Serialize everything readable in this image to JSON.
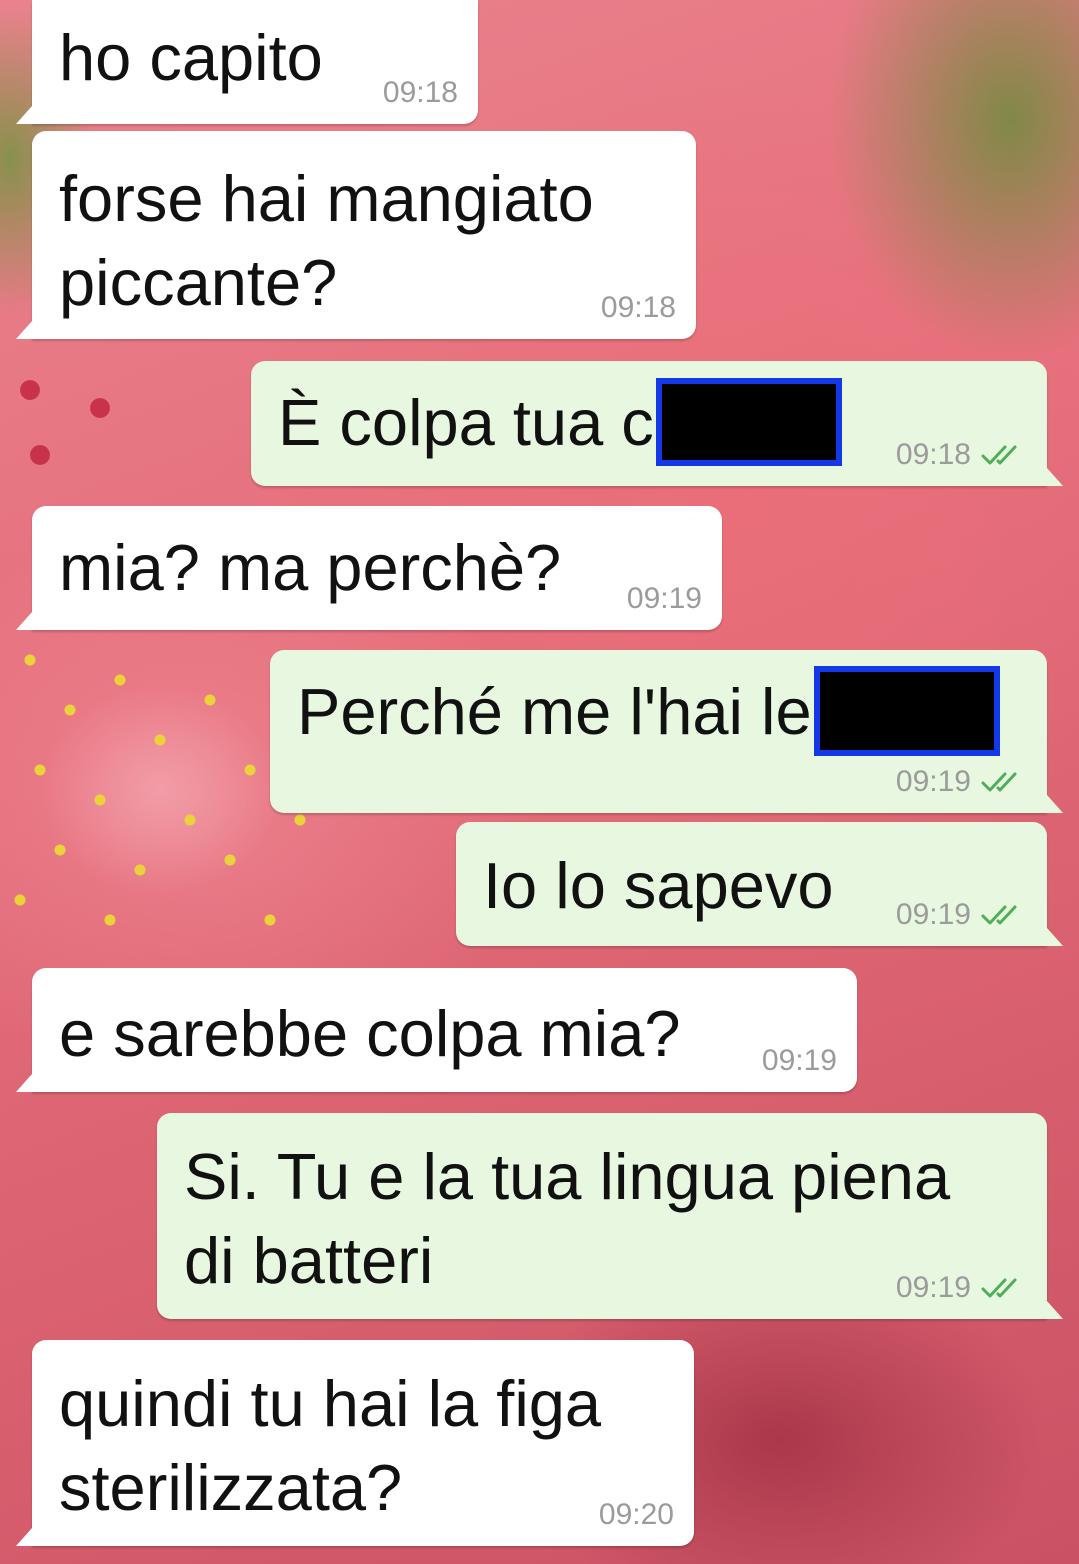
{
  "conversation": {
    "read_tick_color": "#4fae57",
    "messages": [
      {
        "direction": "incoming",
        "text": "ho capito",
        "time": "09:18"
      },
      {
        "direction": "incoming",
        "text": "forse hai mangiato\npiccante?",
        "time": "09:18"
      },
      {
        "direction": "outgoing",
        "text": "È colpa tua c",
        "redacted": true,
        "time": "09:18",
        "status_icon": "double-check-icon"
      },
      {
        "direction": "incoming",
        "text": "mia? ma perchè?",
        "time": "09:19"
      },
      {
        "direction": "outgoing",
        "text": "Perché me l'hai le",
        "redacted": true,
        "time": "09:19",
        "status_icon": "double-check-icon"
      },
      {
        "direction": "outgoing",
        "text": "Io lo sapevo",
        "time": "09:19",
        "status_icon": "double-check-icon"
      },
      {
        "direction": "incoming",
        "text": "e sarebbe colpa mia?",
        "time": "09:19"
      },
      {
        "direction": "outgoing",
        "text": "Si. Tu e la tua lingua piena\ndi batteri",
        "time": "09:19",
        "status_icon": "double-check-icon"
      },
      {
        "direction": "incoming",
        "text": "quindi tu hai la figa\nsterilizzata?",
        "time": "09:20"
      }
    ]
  }
}
